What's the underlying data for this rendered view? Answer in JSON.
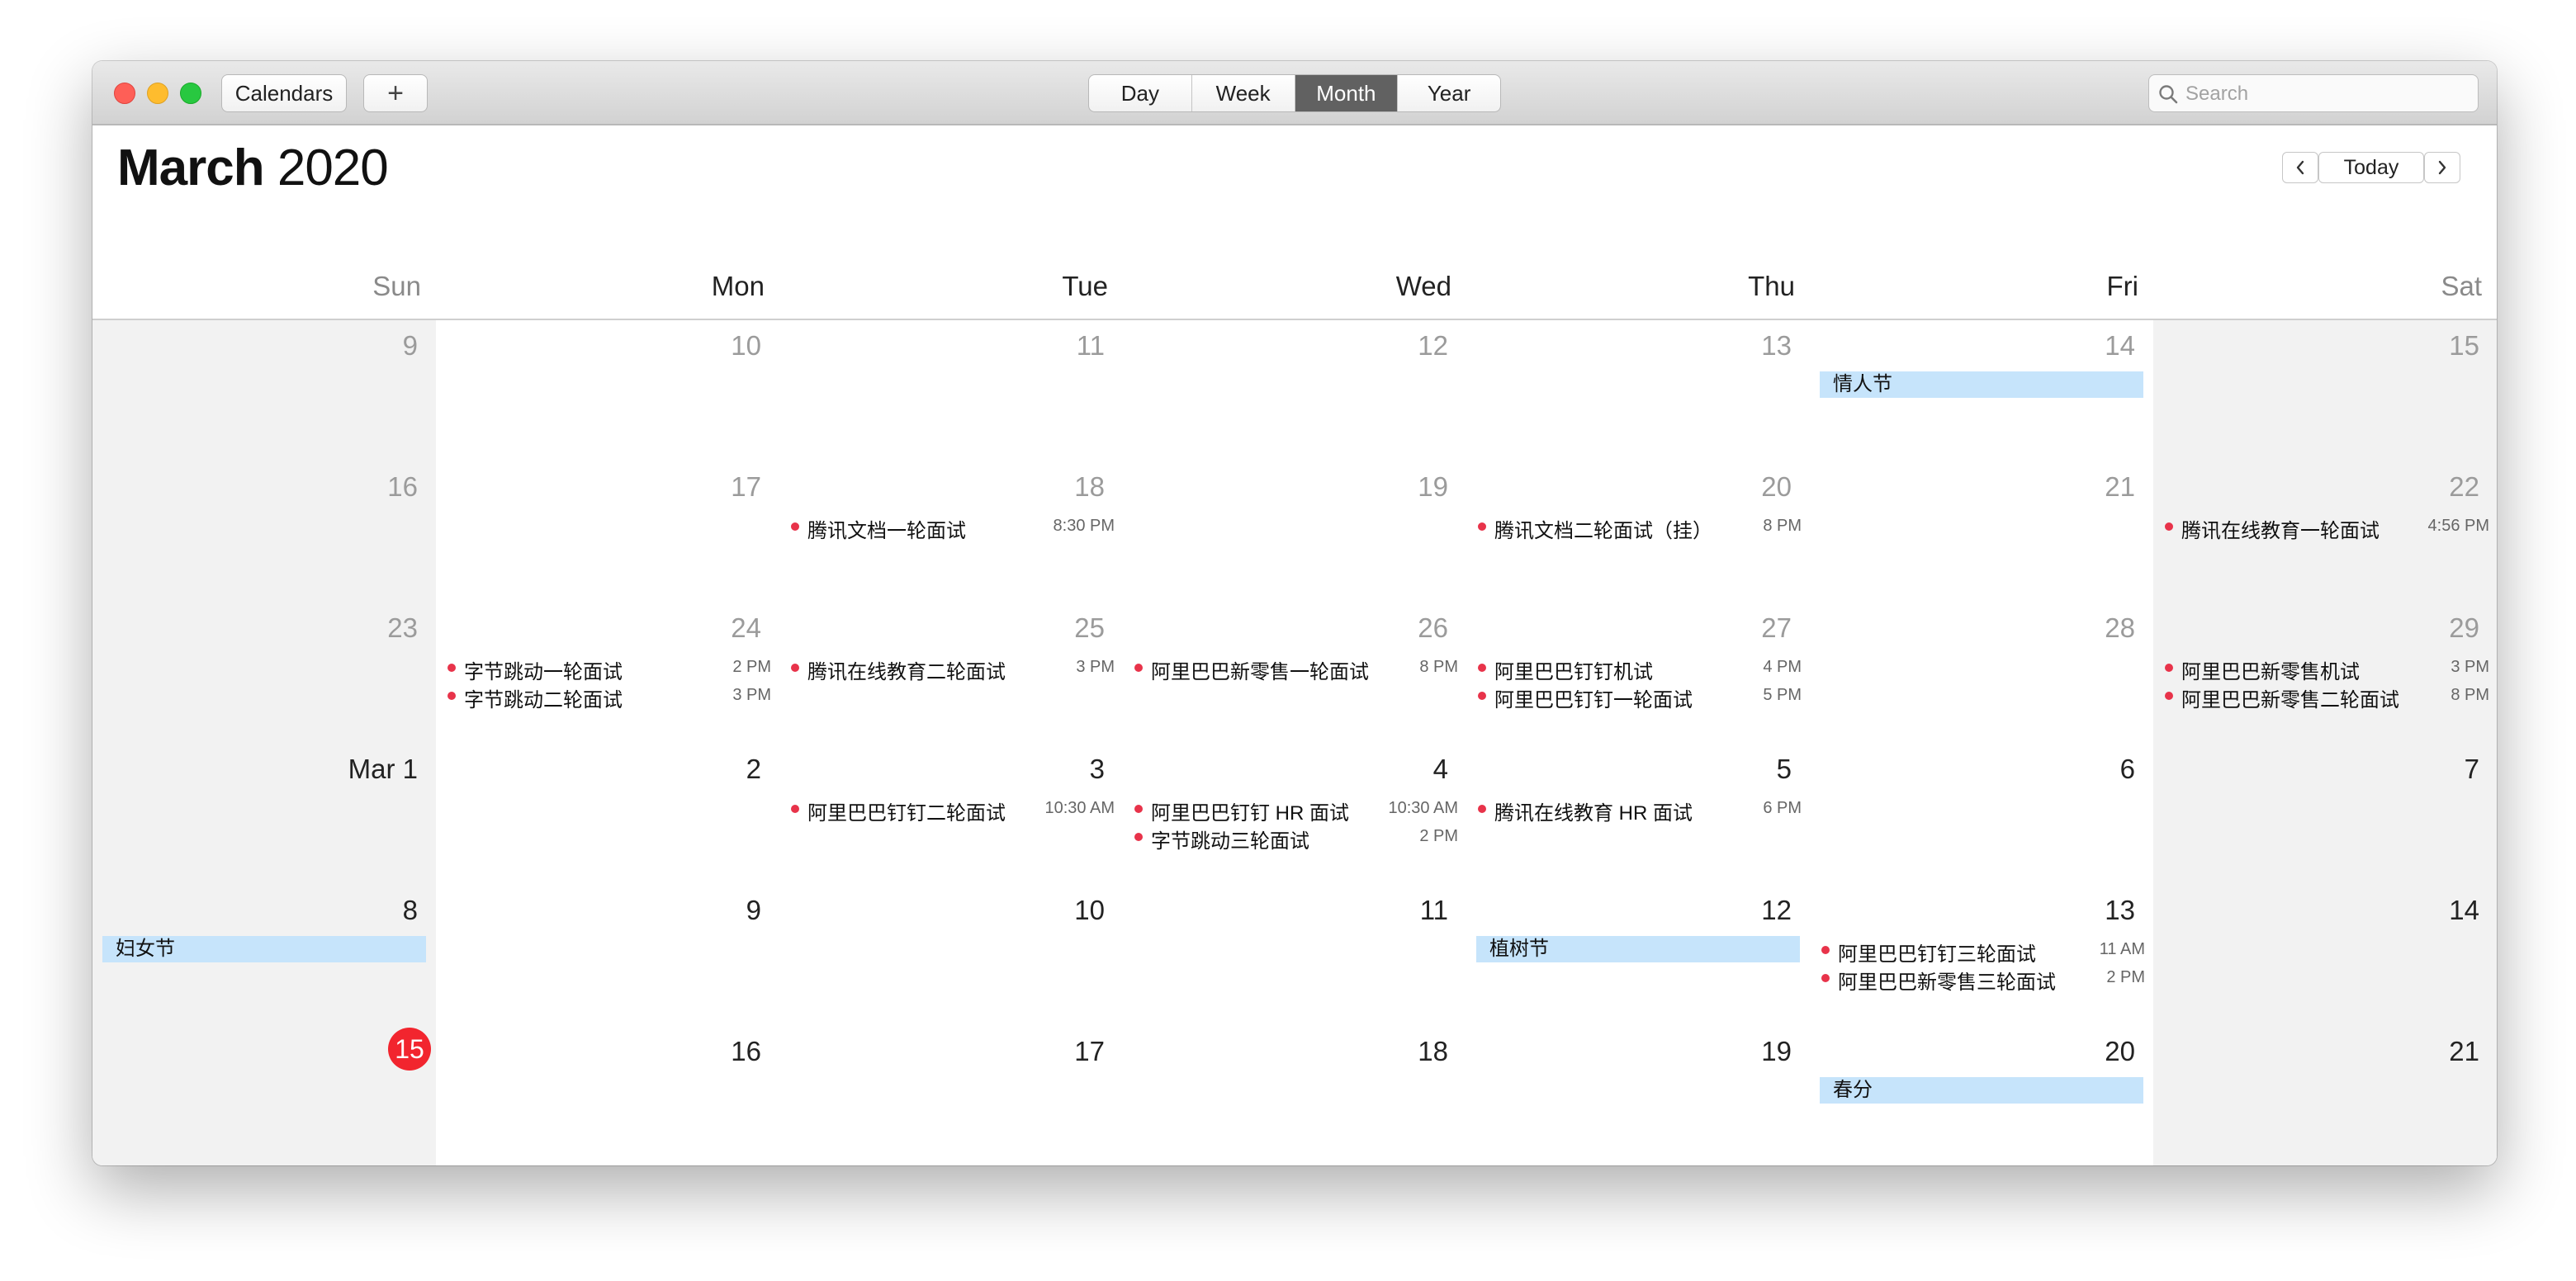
{
  "window": {
    "toolbar": {
      "calendars_label": "Calendars",
      "add_label": "+",
      "views": [
        "Day",
        "Week",
        "Month",
        "Year"
      ],
      "active_view": "Month",
      "search_placeholder": "Search"
    },
    "header": {
      "month": "March",
      "year": "2020",
      "today_label": "Today",
      "prev_label": "‹",
      "next_label": "›"
    },
    "weekdays": [
      "Sun",
      "Mon",
      "Tue",
      "Wed",
      "Thu",
      "Fri",
      "Sat"
    ],
    "weeks": [
      {
        "days": [
          {
            "label": "9",
            "muted": true,
            "allday": null,
            "events": []
          },
          {
            "label": "10",
            "muted": true,
            "allday": null,
            "events": []
          },
          {
            "label": "11",
            "muted": true,
            "allday": null,
            "events": []
          },
          {
            "label": "12",
            "muted": true,
            "allday": null,
            "events": []
          },
          {
            "label": "13",
            "muted": true,
            "allday": null,
            "events": []
          },
          {
            "label": "14",
            "muted": true,
            "allday": "情人节",
            "events": []
          },
          {
            "label": "15",
            "muted": true,
            "allday": null,
            "events": []
          }
        ]
      },
      {
        "days": [
          {
            "label": "16",
            "muted": true,
            "allday": null,
            "events": []
          },
          {
            "label": "17",
            "muted": true,
            "allday": null,
            "events": []
          },
          {
            "label": "18",
            "muted": true,
            "allday": null,
            "events": [
              {
                "title": "腾讯文档一轮面试",
                "time": "8:30 PM"
              }
            ]
          },
          {
            "label": "19",
            "muted": true,
            "allday": null,
            "events": []
          },
          {
            "label": "20",
            "muted": true,
            "allday": null,
            "events": [
              {
                "title": "腾讯文档二轮面试（挂）",
                "time": "8 PM"
              }
            ]
          },
          {
            "label": "21",
            "muted": true,
            "allday": null,
            "events": []
          },
          {
            "label": "22",
            "muted": true,
            "allday": null,
            "events": [
              {
                "title": "腾讯在线教育一轮面试",
                "time": "4:56 PM"
              }
            ]
          }
        ]
      },
      {
        "days": [
          {
            "label": "23",
            "muted": true,
            "allday": null,
            "events": []
          },
          {
            "label": "24",
            "muted": true,
            "allday": null,
            "events": [
              {
                "title": "字节跳动一轮面试",
                "time": "2 PM"
              },
              {
                "title": "字节跳动二轮面试",
                "time": "3 PM"
              }
            ]
          },
          {
            "label": "25",
            "muted": true,
            "allday": null,
            "events": [
              {
                "title": "腾讯在线教育二轮面试",
                "time": "3 PM"
              }
            ]
          },
          {
            "label": "26",
            "muted": true,
            "allday": null,
            "events": [
              {
                "title": "阿里巴巴新零售一轮面试",
                "time": "8 PM"
              }
            ]
          },
          {
            "label": "27",
            "muted": true,
            "allday": null,
            "events": [
              {
                "title": "阿里巴巴钉钉机试",
                "time": "4 PM"
              },
              {
                "title": "阿里巴巴钉钉一轮面试",
                "time": "5 PM"
              }
            ]
          },
          {
            "label": "28",
            "muted": true,
            "allday": null,
            "events": []
          },
          {
            "label": "29",
            "muted": true,
            "allday": null,
            "events": [
              {
                "title": "阿里巴巴新零售机试",
                "time": "3 PM"
              },
              {
                "title": "阿里巴巴新零售二轮面试",
                "time": "8 PM"
              }
            ]
          }
        ]
      },
      {
        "days": [
          {
            "label": "Mar 1",
            "muted": false,
            "allday": null,
            "events": []
          },
          {
            "label": "2",
            "muted": false,
            "allday": null,
            "events": []
          },
          {
            "label": "3",
            "muted": false,
            "allday": null,
            "events": [
              {
                "title": "阿里巴巴钉钉二轮面试",
                "time": "10:30 AM"
              }
            ]
          },
          {
            "label": "4",
            "muted": false,
            "allday": null,
            "events": [
              {
                "title": "阿里巴巴钉钉 HR 面试",
                "time": "10:30 AM"
              },
              {
                "title": "字节跳动三轮面试",
                "time": "2 PM"
              }
            ]
          },
          {
            "label": "5",
            "muted": false,
            "allday": null,
            "events": [
              {
                "title": "腾讯在线教育 HR 面试",
                "time": "6 PM"
              }
            ]
          },
          {
            "label": "6",
            "muted": false,
            "allday": null,
            "events": []
          },
          {
            "label": "7",
            "muted": false,
            "allday": null,
            "events": []
          }
        ]
      },
      {
        "days": [
          {
            "label": "8",
            "muted": false,
            "allday": "妇女节",
            "events": []
          },
          {
            "label": "9",
            "muted": false,
            "allday": null,
            "events": []
          },
          {
            "label": "10",
            "muted": false,
            "allday": null,
            "events": []
          },
          {
            "label": "11",
            "muted": false,
            "allday": null,
            "events": []
          },
          {
            "label": "12",
            "muted": false,
            "allday": "植树节",
            "events": []
          },
          {
            "label": "13",
            "muted": false,
            "allday": null,
            "events": [
              {
                "title": "阿里巴巴钉钉三轮面试",
                "time": "11 AM"
              },
              {
                "title": "阿里巴巴新零售三轮面试",
                "time": "2 PM"
              }
            ]
          },
          {
            "label": "14",
            "muted": false,
            "allday": null,
            "events": []
          }
        ]
      },
      {
        "days": [
          {
            "label": "15",
            "muted": false,
            "today": true,
            "allday": null,
            "events": []
          },
          {
            "label": "16",
            "muted": false,
            "allday": null,
            "events": []
          },
          {
            "label": "17",
            "muted": false,
            "allday": null,
            "events": []
          },
          {
            "label": "18",
            "muted": false,
            "allday": null,
            "events": []
          },
          {
            "label": "19",
            "muted": false,
            "allday": null,
            "events": []
          },
          {
            "label": "20",
            "muted": false,
            "allday": "春分",
            "events": []
          },
          {
            "label": "21",
            "muted": false,
            "allday": null,
            "events": []
          }
        ]
      }
    ]
  }
}
